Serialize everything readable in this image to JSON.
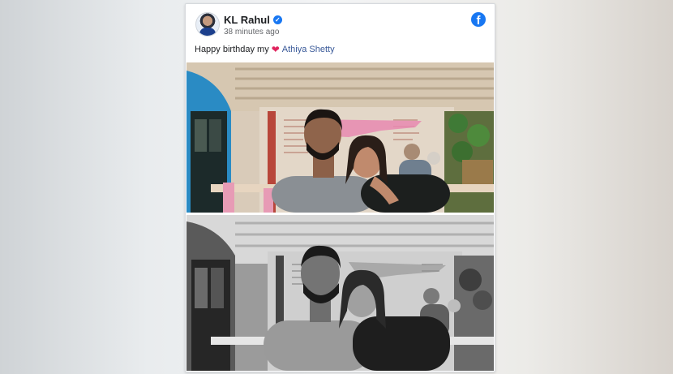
{
  "post": {
    "author": "KL Rahul",
    "time": "38 minutes ago",
    "caption_text": "Happy birthday my",
    "caption_emoji": "❤",
    "mention": "Athiya Shetty"
  },
  "icons": {
    "verified": "verified-badge-icon",
    "platform": "facebook-logo-icon",
    "emoji": "red-heart-emoji-icon"
  },
  "colors": {
    "facebook_blue": "#1877f2",
    "mention_blue": "#385898",
    "heart_red": "#e0245e"
  },
  "photos": [
    {
      "kind": "color",
      "name": "photo-color"
    },
    {
      "kind": "grayscale",
      "name": "photo-black-and-white"
    }
  ]
}
